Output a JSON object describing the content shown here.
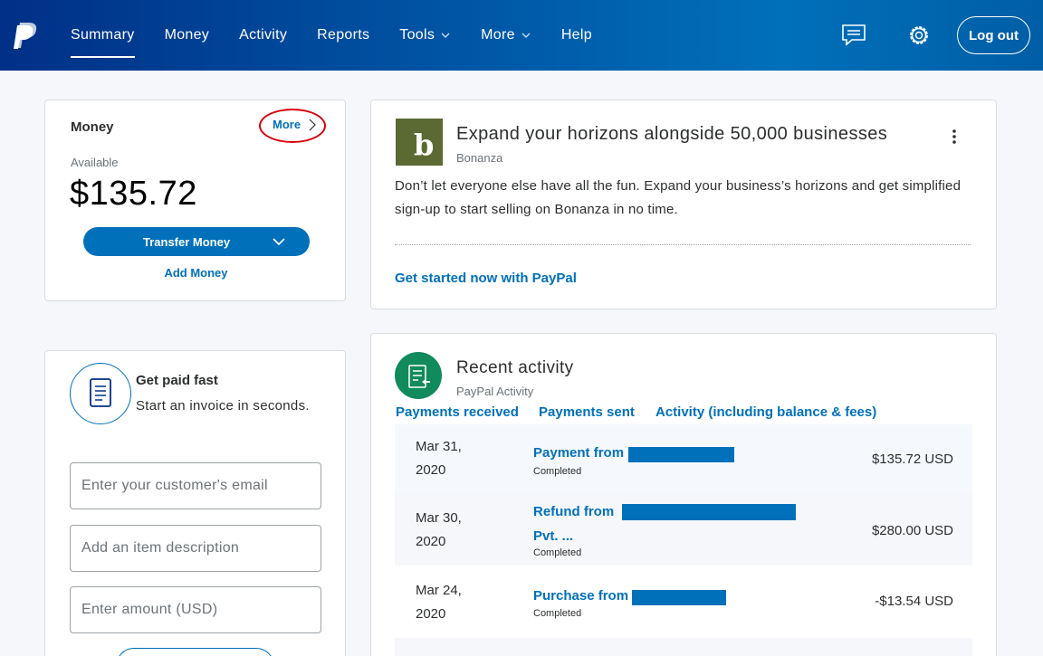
{
  "header": {
    "nav": [
      {
        "label": "Summary",
        "active": true
      },
      {
        "label": "Money"
      },
      {
        "label": "Activity"
      },
      {
        "label": "Reports"
      },
      {
        "label": "Tools",
        "dropdown": true
      },
      {
        "label": "More",
        "dropdown": true
      },
      {
        "label": "Help"
      }
    ],
    "messages_icon": "message-center-icon",
    "settings_icon": "gear-icon",
    "logout_label": "Log out",
    "colors": {
      "bar_start": "#003087",
      "bar_end": "#0070ba"
    }
  },
  "money": {
    "title": "Money",
    "more_label": "More",
    "available_label": "Available",
    "balance": "$135.72",
    "transfer_label": "Transfer Money",
    "add_label": "Add Money"
  },
  "promo": {
    "logo_letter": "b",
    "title": "Expand your horizons alongside 50,000 businesses",
    "source": "Bonanza",
    "body": "Don’t let everyone else have all the fun. Expand your business’s horizons and get simplified sign-up to start selling on Bonanza in no time.",
    "cta": "Get started now with PayPal"
  },
  "invoice": {
    "title": "Get paid fast",
    "subtitle": "Start an invoice in seconds.",
    "email_placeholder": "Enter your customer's email",
    "item_placeholder": "Add an item description",
    "amount_placeholder": "Enter amount (USD)"
  },
  "activity": {
    "title": "Recent activity",
    "subtitle": "PayPal Activity",
    "tabs": [
      "Payments received",
      "Payments sent",
      "Activity (including balance & fees)"
    ],
    "rows": [
      {
        "date_line1": "Mar 31,",
        "date_line2": "2020",
        "name": "Payment from",
        "name_line2": "",
        "status": "Completed",
        "amount": "$135.72 USD"
      },
      {
        "date_line1": "Mar 30,",
        "date_line2": "2020",
        "name": "Refund from",
        "name_line2": "Pvt. ...",
        "status": "Completed",
        "amount": "$280.00 USD"
      },
      {
        "date_line1": "Mar 24,",
        "date_line2": "2020",
        "name": "Purchase from",
        "name_line2": "",
        "status": "Completed",
        "amount": "-$13.54 USD"
      }
    ]
  }
}
